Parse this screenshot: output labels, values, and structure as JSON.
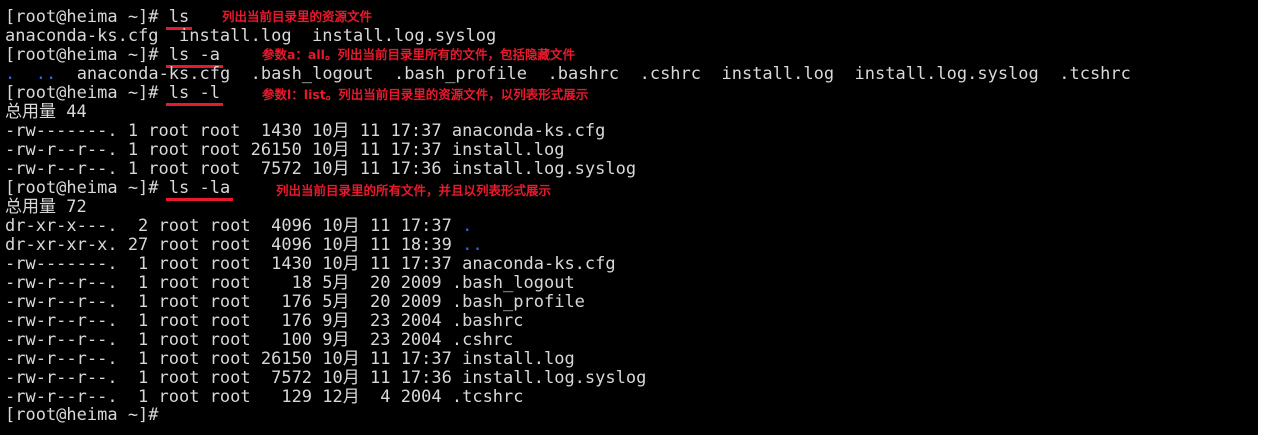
{
  "colors": {
    "background": "#000000",
    "text": "#d8d8d8",
    "annotation": "#e8192c",
    "directory": "#2f6fe0"
  },
  "prompt": "[root@heima ~]# ",
  "commands": {
    "ls": "ls",
    "ls_a": "ls -a",
    "ls_l": "ls -l",
    "ls_la": "ls -la"
  },
  "annotations": {
    "ls": "列出当前目录里的资源文件",
    "ls_a": "参数a：all。列出当前目录里所有的文件，包括隐藏文件",
    "ls_l": "参数l：list。列出当前目录里的资源文件，以列表形式展示",
    "ls_la": "列出当前目录里的所有文件，并且以列表形式展示"
  },
  "output": {
    "ls": "anaconda-ks.cfg  install.log  install.log.syslog",
    "ls_a_dot": ".",
    "ls_a_dotdot": "..",
    "ls_a_rest": "  anaconda-ks.cfg  .bash_logout  .bash_profile  .bashrc  .cshrc  install.log  install.log.syslog  .tcshrc",
    "ls_l_total": "总用量 44",
    "ls_l_rows": [
      "-rw-------. 1 root root  1430 10月 11 17:37 anaconda-ks.cfg",
      "-rw-r--r--. 1 root root 26150 10月 11 17:37 install.log",
      "-rw-r--r--. 1 root root  7572 10月 11 17:36 install.log.syslog"
    ],
    "ls_la_total": "总用量 72",
    "ls_la_dir1": "dr-xr-x---.  2 root root  4096 10月 11 17:37 ",
    "ls_la_dir1_name": ".",
    "ls_la_dir2": "dr-xr-xr-x. 27 root root  4096 10月 11 18:39 ",
    "ls_la_dir2_name": "..",
    "ls_la_rows": [
      "-rw-------.  1 root root  1430 10月 11 17:37 anaconda-ks.cfg",
      "-rw-r--r--.  1 root root    18 5月  20 2009 .bash_logout",
      "-rw-r--r--.  1 root root   176 5月  20 2009 .bash_profile",
      "-rw-r--r--.  1 root root   176 9月  23 2004 .bashrc",
      "-rw-r--r--.  1 root root   100 9月  23 2004 .cshrc",
      "-rw-r--r--.  1 root root 26150 10月 11 17:37 install.log",
      "-rw-r--r--.  1 root root  7572 10月 11 17:36 install.log.syslog",
      "-rw-r--r--.  1 root root   129 12月  4 2004 .tcshrc"
    ]
  }
}
